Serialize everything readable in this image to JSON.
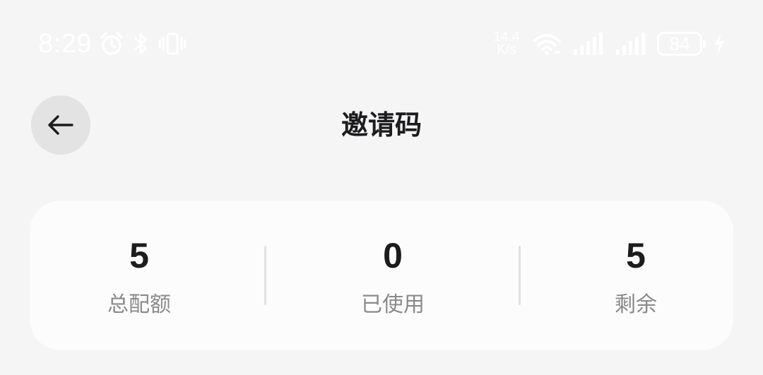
{
  "status_bar": {
    "time": "8:29",
    "net_speed_value": "14.4",
    "net_speed_unit": "K/s",
    "battery_level": "84",
    "icons": [
      "alarm-icon",
      "bluetooth-icon",
      "vibrate-icon",
      "wifi-icon",
      "signal-icon",
      "signal-icon",
      "battery-icon",
      "charging-icon"
    ]
  },
  "header": {
    "back_icon": "arrow-left-icon",
    "title": "邀请码"
  },
  "stats": [
    {
      "value": "5",
      "label": "总配额"
    },
    {
      "value": "0",
      "label": "已使用"
    },
    {
      "value": "5",
      "label": "剩余"
    }
  ],
  "colors": {
    "background": "#f5f5f5",
    "card": "#fcfcfc",
    "back_button_bg": "#e3e3e3",
    "primary_text": "#1c1c1e",
    "secondary_text": "#8a8a8e",
    "status_bar_text": "#ffffff"
  }
}
